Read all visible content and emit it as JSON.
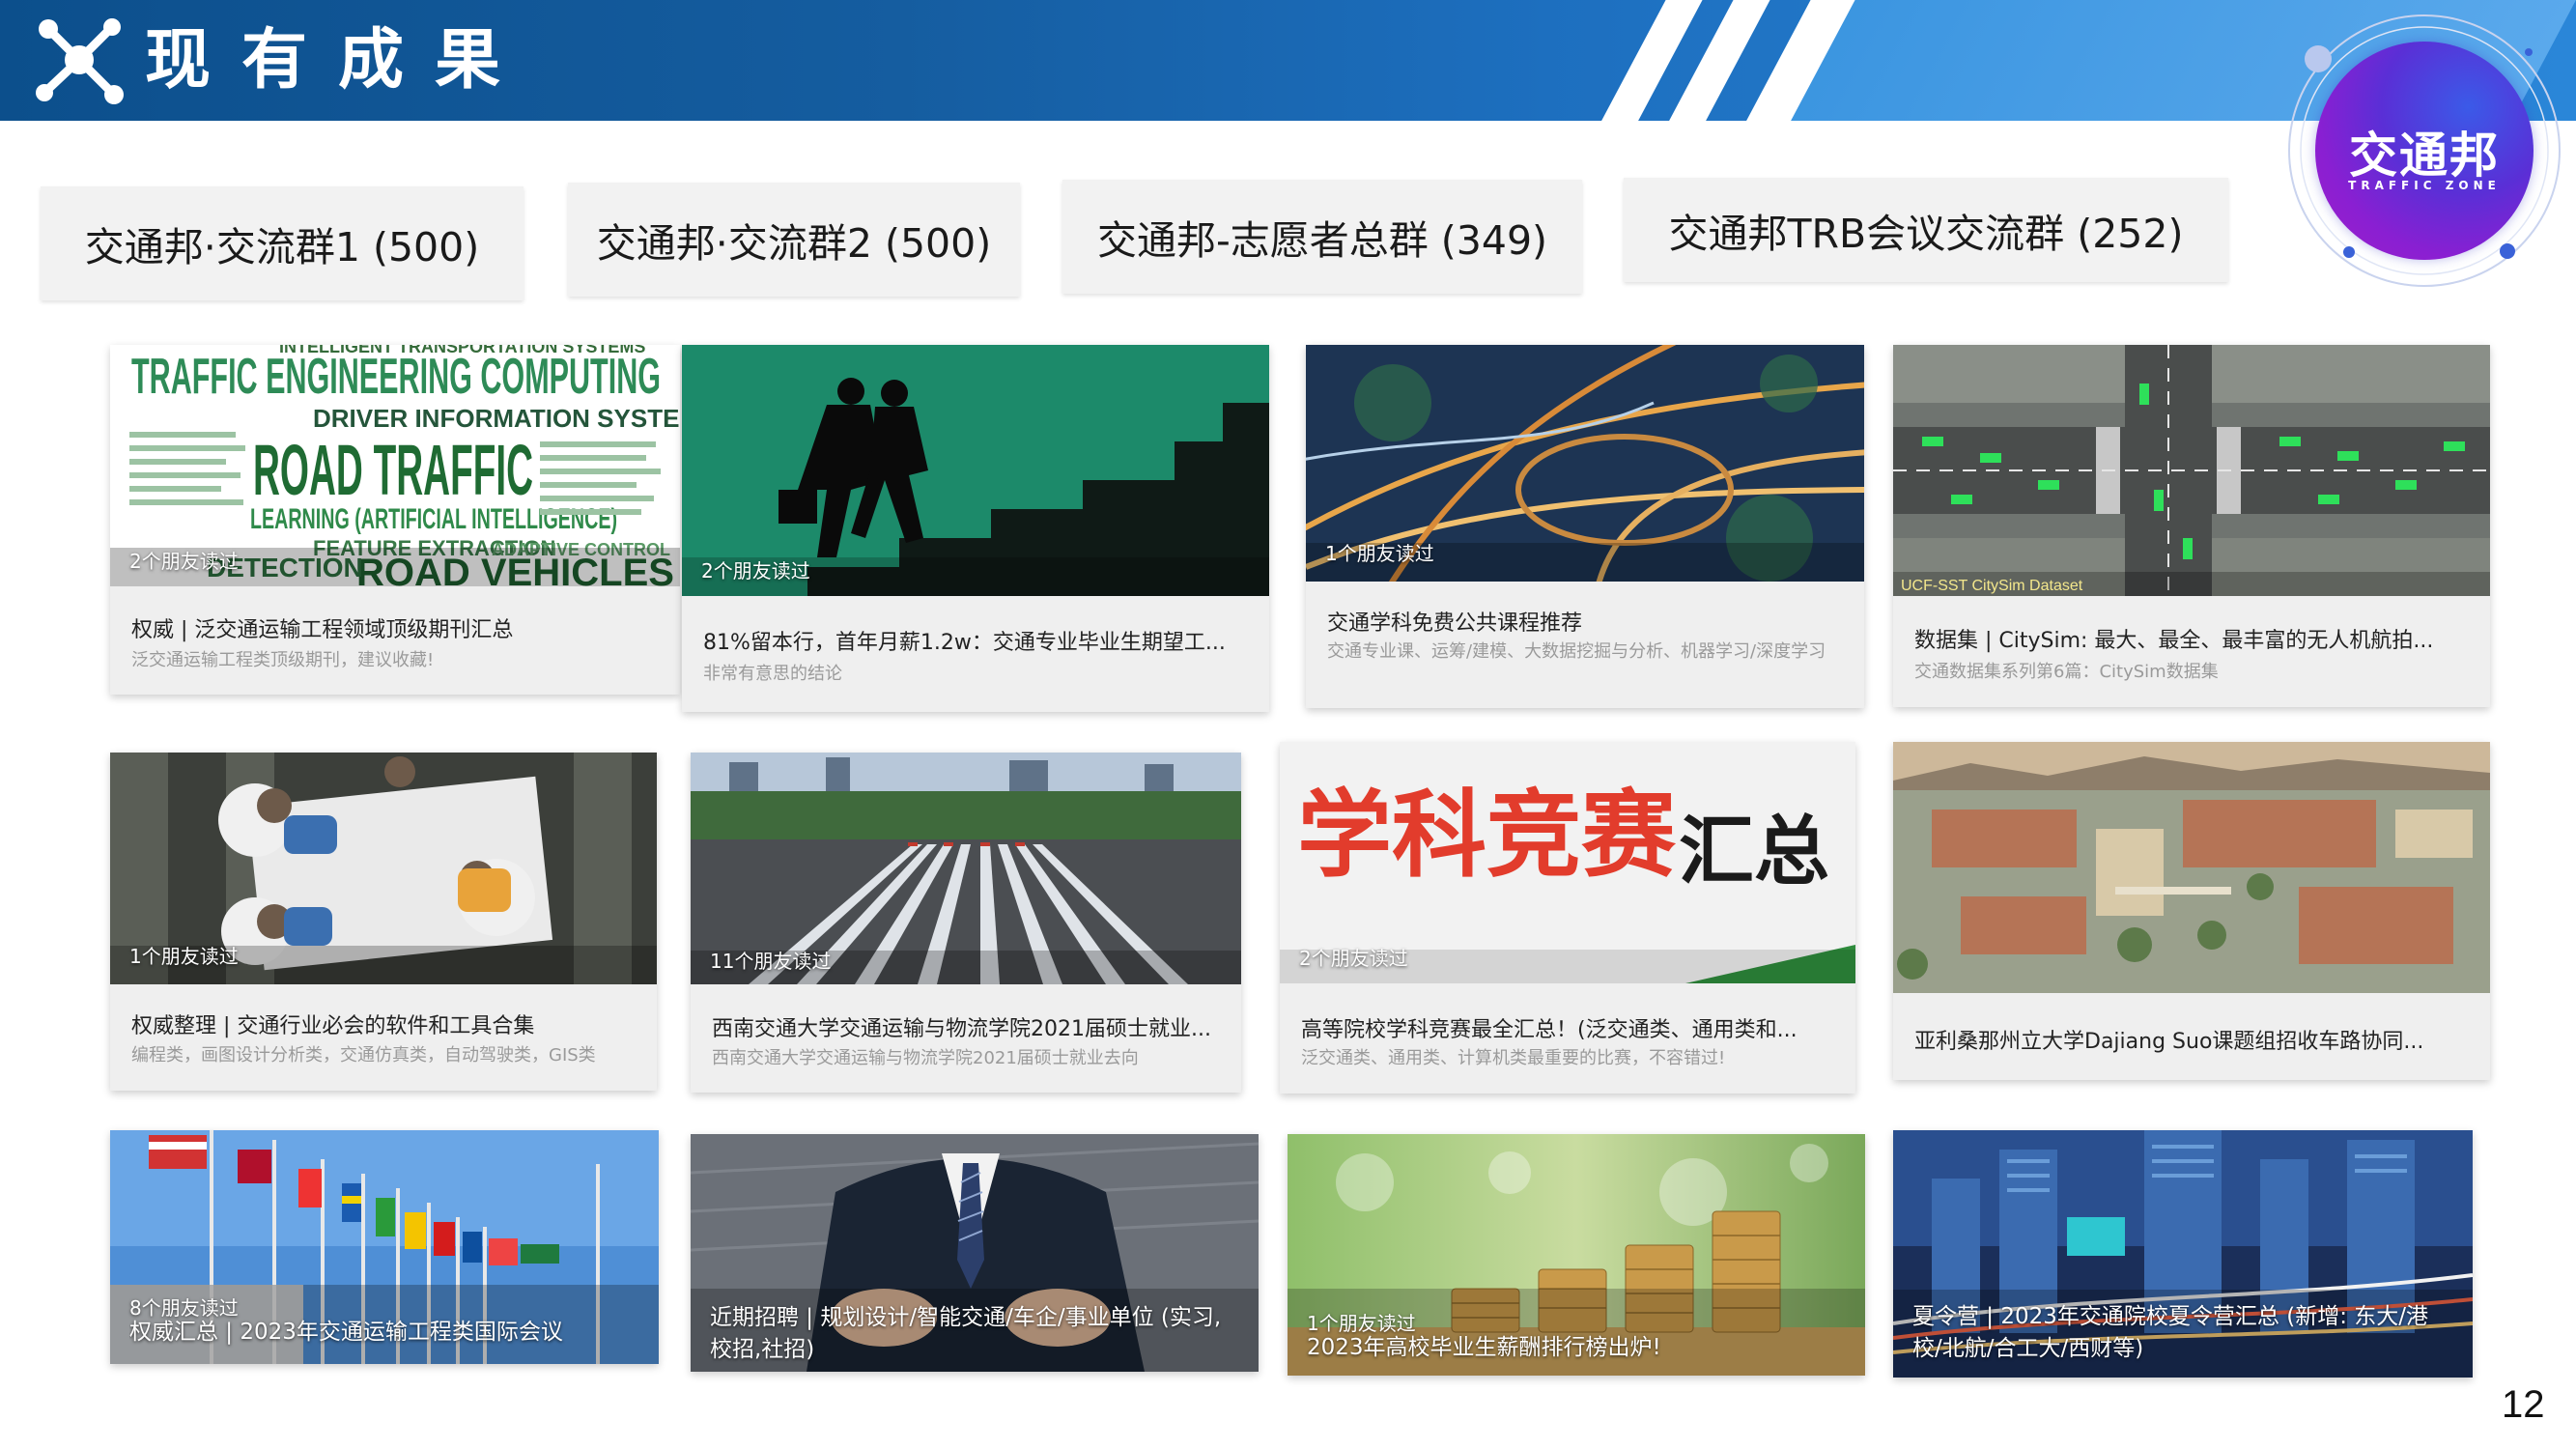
{
  "header": {
    "title": "现有成果",
    "brand_name": "交通邦",
    "brand_sub": "TRAFFIC ZONE",
    "colors": {
      "primary": "#155da0",
      "accent": "#2a86d8"
    }
  },
  "groups": [
    {
      "label": "交通邦·交流群1 (500)"
    },
    {
      "label": "交通邦·交流群2 (500)"
    },
    {
      "label": "交通邦-志愿者总群 (349)"
    },
    {
      "label": "交通邦TRB会议交流群 (252)"
    }
  ],
  "cards": [
    {
      "count": "2个朋友读过",
      "title": "权威 | 泛交通运输工程领域顶级期刊汇总",
      "subtitle": "泛交通运输工程类顶级期刊，建议收藏!",
      "image": "word-cloud",
      "cloud": [
        "INTELLIGENT TRANSPORTATION SYSTEMS",
        "TRAFFIC ENGINEERING COMPUTING",
        "DRIVER INFORMATION SYSTEMS",
        "ROAD TRAFFIC",
        "LEARNING (ARTIFICIAL INTELLIGENCE)",
        "ROAD VEHICLES",
        "FEATURE EXTRACTION",
        "ADAPTIVE CONTROL",
        "DETECTION"
      ]
    },
    {
      "count": "2个朋友读过",
      "title": "81%留本行，首年月薪1.2w：交通专业毕业生期望工...",
      "subtitle": "非常有意思的结论",
      "image": "stairs-businessman"
    },
    {
      "count": "1个朋友读过",
      "title": "交通学科免费公共课程推荐",
      "subtitle": "交通专业课、运筹/建模、大数据挖掘与分析、机器学习/深度学习",
      "image": "night-interchange"
    },
    {
      "count": "",
      "title": "数据集 | CitySim: 最大、最全、最丰富的无人机航拍...",
      "subtitle": "交通数据集系列第6篇：CitySim数据集",
      "image": "drone-intersection",
      "caption": "UCF-SST CitySim Dataset"
    },
    {
      "count": "1个朋友读过",
      "title": "权威整理 | 交通行业必会的软件和工具合集",
      "subtitle": "编程类，画图设计分析类，交通仿真类，自动驾驶类，GIS类",
      "image": "meeting-table"
    },
    {
      "count": "11个朋友读过",
      "title": "西南交通大学交通运输与物流学院2021届硕士就业...",
      "subtitle": "西南交通大学交通运输与物流学院2021届硕士就业去向",
      "image": "train-depot"
    },
    {
      "count": "2个朋友读过",
      "title": "高等院校学科竞赛最全汇总！(泛交通类、通用类和...",
      "subtitle": "泛交通类、通用类、计算机类最重要的比赛，不容错过!",
      "image": "competition-banner",
      "banner_red": "学科竞赛",
      "banner_dark": "汇总"
    },
    {
      "count": "",
      "title": "亚利桑那州立大学Dajiang Suo课题组招收车路协同...",
      "subtitle": "",
      "image": "campus-aerial"
    },
    {
      "count": "8个朋友读过",
      "overlay_title": "权威汇总 | 2023年交通运输工程类国际会议",
      "image": "flags"
    },
    {
      "count": "",
      "overlay_title": "近期招聘 | 规划设计/智能交通/车企/事业单位 (实习, 校招,社招)",
      "image": "suit"
    },
    {
      "count": "1个朋友读过",
      "overlay_title": "2023年高校毕业生薪酬排行榜出炉!",
      "image": "coins"
    },
    {
      "count": "",
      "overlay_title": "夏令营 | 2023年交通院校夏令营汇总 (新增: 东大/港校/北航/合工大/西财等)",
      "image": "city-night"
    }
  ],
  "page_number": "12"
}
